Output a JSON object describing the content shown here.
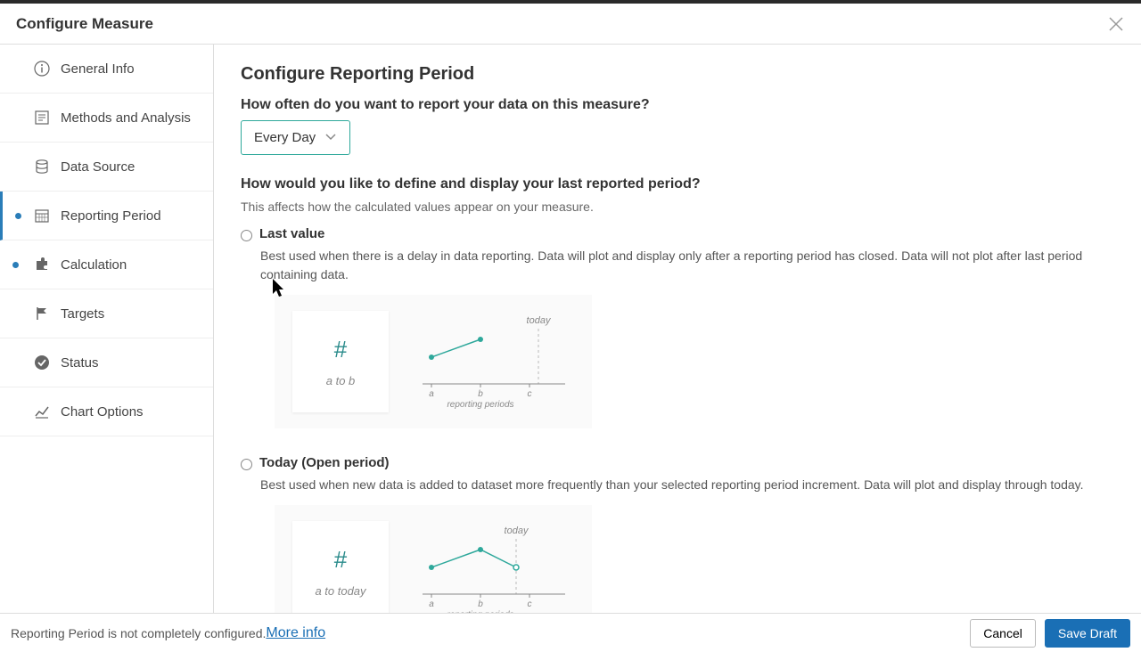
{
  "header": {
    "title": "Configure Measure"
  },
  "sidebar": {
    "items": [
      {
        "label": "General Info"
      },
      {
        "label": "Methods and Analysis"
      },
      {
        "label": "Data Source"
      },
      {
        "label": "Reporting Period"
      },
      {
        "label": "Calculation"
      },
      {
        "label": "Targets"
      },
      {
        "label": "Status"
      },
      {
        "label": "Chart Options"
      }
    ]
  },
  "content": {
    "page_title": "Configure Reporting Period",
    "q1": "How often do you want to report your data on this measure?",
    "dropdown_value": "Every Day",
    "q2": "How would you like to define and display your last reported period?",
    "q2_sub": "This affects how the calculated values appear on your measure.",
    "opt1": {
      "title": "Last value",
      "desc": "Best used when there is a delay in data reporting. Data will plot and display only after a reporting period has closed. Data will not plot after last period containing data.",
      "card_label": "a to b",
      "today": "today",
      "axis_label": "reporting periods",
      "ticks": [
        "a",
        "b",
        "c"
      ]
    },
    "opt2": {
      "title": "Today (Open period)",
      "desc": "Best used when new data is added to dataset more frequently than your selected reporting period increment. Data will plot and display through today.",
      "card_label": "a to today",
      "today": "today",
      "axis_label": "reporting periods",
      "ticks": [
        "a",
        "b",
        "c"
      ]
    }
  },
  "footer": {
    "msg": "Reporting Period is not completely configured. ",
    "link": "More info",
    "cancel": "Cancel",
    "save": "Save Draft"
  }
}
